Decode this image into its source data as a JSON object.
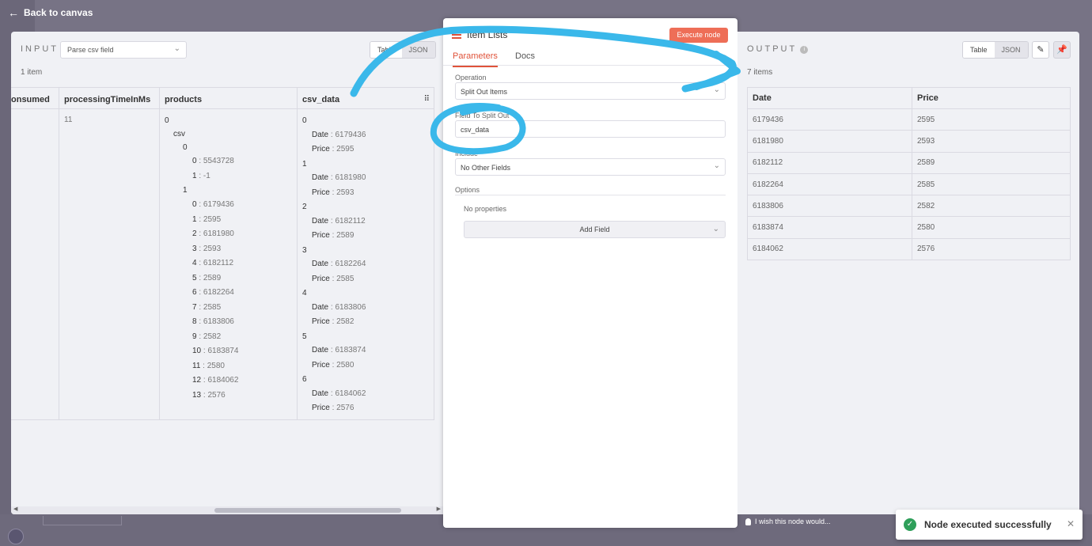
{
  "nav": {
    "back_label": "Back to canvas"
  },
  "input": {
    "title": "INPUT",
    "node": "Parse csv field",
    "view_toggle": [
      "Table",
      "JSON"
    ],
    "item_count": "1 item",
    "columns": [
      "onsumed",
      "processingTimeInMs",
      "products",
      "csv_data"
    ],
    "processing_time": "11",
    "products_tree": {
      "root_index": "0",
      "key": "csv",
      "group0_index": "0",
      "group0": [
        {
          "k": "0",
          "v": "5543728"
        },
        {
          "k": "1",
          "v": "-1"
        }
      ],
      "group1_index": "1",
      "group1": [
        {
          "k": "0",
          "v": "6179436"
        },
        {
          "k": "1",
          "v": "2595"
        },
        {
          "k": "2",
          "v": "6181980"
        },
        {
          "k": "3",
          "v": "2593"
        },
        {
          "k": "4",
          "v": "6182112"
        },
        {
          "k": "5",
          "v": "2589"
        },
        {
          "k": "6",
          "v": "6182264"
        },
        {
          "k": "7",
          "v": "2585"
        },
        {
          "k": "8",
          "v": "6183806"
        },
        {
          "k": "9",
          "v": "2582"
        },
        {
          "k": "10",
          "v": "6183874"
        },
        {
          "k": "11",
          "v": "2580"
        },
        {
          "k": "12",
          "v": "6184062"
        },
        {
          "k": "13",
          "v": "2576"
        }
      ]
    },
    "csv_data": [
      {
        "i": "0",
        "date": "6179436",
        "price": "2595"
      },
      {
        "i": "1",
        "date": "6181980",
        "price": "2593"
      },
      {
        "i": "2",
        "date": "6182112",
        "price": "2589"
      },
      {
        "i": "3",
        "date": "6182264",
        "price": "2585"
      },
      {
        "i": "4",
        "date": "6183806",
        "price": "2582"
      },
      {
        "i": "5",
        "date": "6183874",
        "price": "2580"
      },
      {
        "i": "6",
        "date": "6184062",
        "price": "2576"
      }
    ],
    "date_key": "Date",
    "price_key": "Price"
  },
  "params": {
    "node_name": "Item Lists",
    "execute_label": "Execute node",
    "tabs": [
      "Parameters",
      "Docs"
    ],
    "operation_label": "Operation",
    "operation_value": "Split Out Items",
    "field_label": "Field To Split Out",
    "field_value": "csv_data",
    "include_label": "Include",
    "include_value": "No Other Fields",
    "options_label": "Options",
    "no_properties": "No properties",
    "add_field_label": "Add Field"
  },
  "output": {
    "title": "OUTPUT",
    "view_toggle": [
      "Table",
      "JSON"
    ],
    "item_count": "7 items",
    "columns": [
      "Date",
      "Price"
    ],
    "rows": [
      [
        "6179436",
        "2595"
      ],
      [
        "6181980",
        "2593"
      ],
      [
        "6182112",
        "2589"
      ],
      [
        "6182264",
        "2585"
      ],
      [
        "6183806",
        "2582"
      ],
      [
        "6183874",
        "2580"
      ],
      [
        "6184062",
        "2576"
      ]
    ]
  },
  "wish_label": "I wish this node would...",
  "toast": {
    "message": "Node executed successfully"
  },
  "colors": {
    "accent": "#ee6e57",
    "tab_active": "#e0533a",
    "annotation": "#3ab8ea",
    "success": "#2e9f5a"
  }
}
